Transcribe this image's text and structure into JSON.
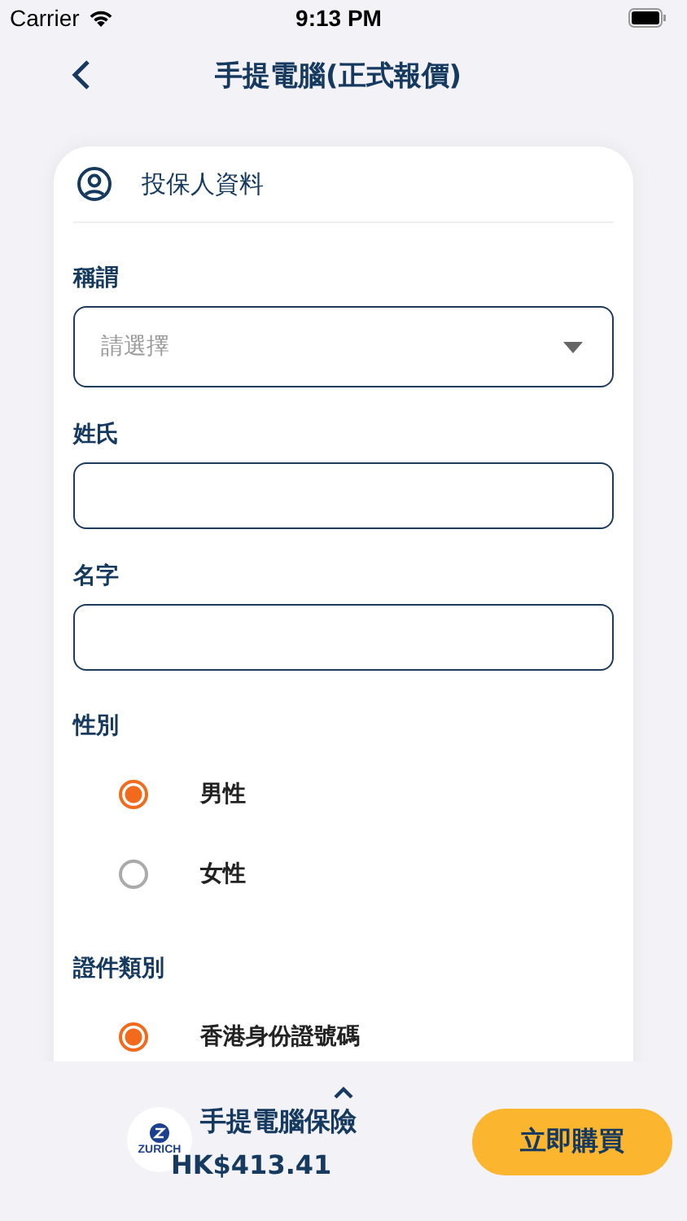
{
  "status_bar": {
    "carrier": "Carrier",
    "time": "9:13 PM"
  },
  "header": {
    "title": "手提電腦(正式報價)"
  },
  "section": {
    "title": "投保人資料"
  },
  "fields": [
    {
      "kind": "select",
      "label": "稱謂",
      "placeholder": "請選擇"
    },
    {
      "kind": "input",
      "label": "姓氏"
    },
    {
      "kind": "input",
      "label": "名字"
    },
    {
      "kind": "radio",
      "label": "性別",
      "options": [
        {
          "label": "男性",
          "selected": true
        },
        {
          "label": "女性",
          "selected": false
        }
      ]
    },
    {
      "kind": "radio",
      "label": "證件類別",
      "options": [
        {
          "label": "香港身份證號碼",
          "selected": true
        }
      ]
    }
  ],
  "footer": {
    "logo_text": "ZURICH",
    "product": "手提電腦保險",
    "price": "HK$413.41",
    "buy_button": "立即購買"
  }
}
